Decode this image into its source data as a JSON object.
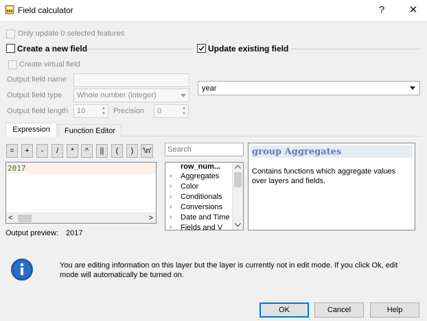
{
  "window": {
    "title": "Field calculator",
    "help_glyph": "?",
    "close_glyph": "✕"
  },
  "options": {
    "only_update_selected": "Only update 0 selected features",
    "create_new_field": "Create a new field",
    "update_existing_field": "Update existing field",
    "create_virtual_field": "Create virtual field",
    "output_field_name_label": "Output field name",
    "output_field_type_label": "Output field type",
    "output_field_type_value": "Whole number (integer)",
    "output_field_length_label": "Output field length",
    "output_field_length_value": "10",
    "precision_label": "Precision",
    "precision_value": "0",
    "existing_field_value": "year"
  },
  "tabs": [
    {
      "label": "Expression"
    },
    {
      "label": "Function Editor"
    }
  ],
  "operators": [
    "=",
    "+",
    "-",
    "/",
    "*",
    "^",
    "||",
    "(",
    ")",
    "'\\n'"
  ],
  "expression": {
    "text": "2017",
    "scroll_left": "<",
    "scroll_right": ">"
  },
  "search": {
    "placeholder": "Search"
  },
  "function_tree": {
    "items": [
      {
        "label": "row_num...",
        "bold": true,
        "expandable": false
      },
      {
        "label": "Aggregates",
        "bold": false,
        "expandable": true
      },
      {
        "label": "Color",
        "bold": false,
        "expandable": true
      },
      {
        "label": "Conditionals",
        "bold": false,
        "expandable": true
      },
      {
        "label": "Conversions",
        "bold": false,
        "expandable": true
      },
      {
        "label": "Date and Time",
        "bold": false,
        "expandable": true
      },
      {
        "label": "Fields and V",
        "bold": false,
        "expandable": true
      }
    ]
  },
  "help_panel": {
    "heading": "group Aggregates",
    "body": "Contains functions which aggregate values over layers and fields."
  },
  "preview": {
    "label": "Output preview:",
    "value": "2017"
  },
  "info": {
    "message": "You are editing information on this layer but the layer is currently not in edit mode. If you click Ok, edit mode will automatically be turned on.",
    "icon_letter": "i"
  },
  "buttons": {
    "ok": "OK",
    "cancel": "Cancel",
    "help": "Help"
  },
  "colors": {
    "accent": "#0078d7",
    "help_heading": "#5b7db6",
    "expression_text": "#2a7a2a",
    "info_icon": "#1f5fb4"
  }
}
